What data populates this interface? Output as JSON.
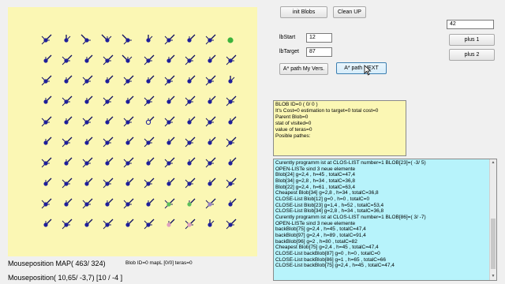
{
  "map": {
    "cells": [
      [
        "NE",
        "N",
        "NW",
        "NW",
        "NW",
        "N",
        "NE",
        "NE",
        "NE",
        "goal"
      ],
      [
        "NE",
        "NE",
        "NE",
        "NE",
        "NW",
        "NE",
        "NE",
        "NE",
        "NE",
        "NE"
      ],
      [
        "NE",
        "NE",
        "NE",
        "NE",
        "NE",
        "NE",
        "NE",
        "NE",
        "NE",
        "N"
      ],
      [
        "NE",
        "NE",
        "NE",
        "NE",
        "NE",
        "NE",
        "NE",
        "NE",
        "NE",
        "NE"
      ],
      [
        "NE",
        "NE",
        "NE",
        "NE",
        "NE",
        "up-open",
        "NE",
        "NE",
        "NE",
        "NE"
      ],
      [
        "NE",
        "NE",
        "NE",
        "NE",
        "NE",
        "NE",
        "NE",
        "NE",
        "NE",
        "NE"
      ],
      [
        "NE",
        "NE",
        "NE",
        "NE",
        "NE",
        "NE",
        "NE",
        "NE",
        "NE",
        "NE"
      ],
      [
        "NE",
        "NE",
        "NE",
        "NE",
        "NE",
        "NE",
        "NE",
        "NE",
        "NE",
        "NE"
      ],
      [
        "NE",
        "NE",
        "NE",
        "NE",
        "NE",
        "NE",
        "path-green",
        "path-green",
        "path-purple",
        "NE"
      ],
      [
        "NE",
        "NE",
        "NE",
        "NE",
        "NE",
        "NE",
        "path-pink",
        "path-pink",
        "N",
        "NE"
      ]
    ],
    "colors": {
      "background": "#fbf7b4",
      "blob": "#1f1f9a",
      "line": "#101060",
      "goal": "#3cb33c",
      "path-green": "#5cbf5c",
      "path-purple": "#9a85c8",
      "path-pink": "#e0a0c0",
      "open": "#fbf7b4"
    }
  },
  "status": {
    "mouse_map": "Mouseposition MAP( 463/ 324)",
    "mouse_pos": "Mouseposition( 10,65/ -3,7) [10 / -4 ]",
    "blob_info": "Blob ID=0 mapL [0/0]  teras=0"
  },
  "buttons": {
    "init": "init Blobs",
    "clean": "Clean UP",
    "plus1": "plus 1",
    "plus2": "plus 2",
    "apath_my": "A* path My Vers.",
    "apath_next": "A* path NEXT"
  },
  "fields": {
    "number_value": "42",
    "start_label": "lbStart",
    "start_value": "12",
    "target_label": "lbTarget",
    "target_value": "87"
  },
  "info": {
    "lines": [
      "BLOB ID=0  ( 0/ 0 )",
      "It's Cost=0 estimation to target=0 total cost=0",
      "Parent Blob=0",
      "stat of visited=0",
      "value of teras=0",
      "Posible pathes:"
    ]
  },
  "log": {
    "lines": [
      "Curently programm ist at CLOS-LIST number=1 BLOB[23]=( -3/ 5)",
      "OPEN-LISTe sind 3 neue elemente",
      "Blob[24] g=2,4  , h=45  , totalC=47,4",
      "Blob[34] g=2,8  , h=34  , totalC=36,8",
      "Blob[22] g=2,4  , h=61  , totalC=63,4",
      "Cheapest Blob[34] g=2,8  , h=34  , totalC=36,8",
      "CLOSE-List Blob[12] g=0  , h=0  , totalC=0",
      "CLOSE-List Blob[23] g=1,4  , h=52  , totalC=53,4",
      "CLOSE-List Blob[34] g=2,8  , h=34  , totalC=36,8",
      "Curently programm ist at CLOS-LIST number=1 BLOB[86]=( 3/ -7)",
      "OPEN-LISTe sind 3 neue elemente",
      "backBlob[75] g=2,4  , h=45  , totalC=47,4",
      "backBlob[97] g=2,4  , h=89  , totalC=91,4",
      "backBlob[96] g=2  , h=80  , totalC=82",
      "Cheapest Blob[75] g=2,4  , h=45  , totalC=47,4",
      "CLOSE-List backBlob[87] g=0  , h=0  , totalC=0",
      "CLOSE-List backBlob[86] g=1  , h=65  , totalC=66",
      "CLOSE-List backBlob[75] g=2,4  , h=45  , totalC=47,4"
    ]
  }
}
